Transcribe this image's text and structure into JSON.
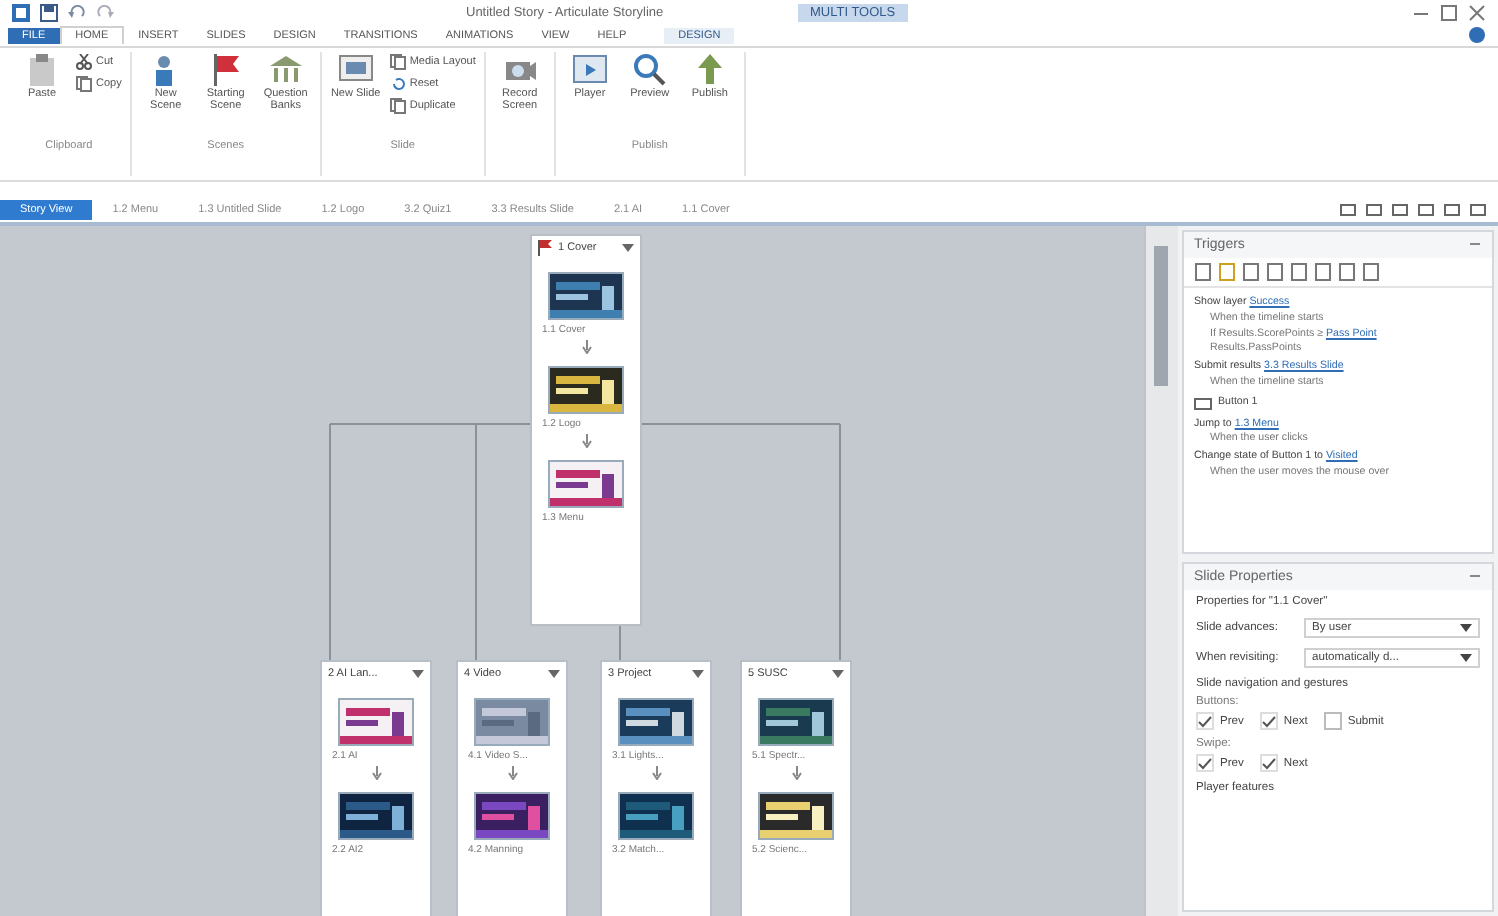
{
  "window": {
    "title": "Untitled Story - Articulate Storyline",
    "contextual_tab": "MULTI TOOLS"
  },
  "ribbon_tabs": [
    {
      "label": "FILE",
      "selected": false,
      "kind": "file"
    },
    {
      "label": "HOME",
      "selected": true,
      "kind": "tab"
    },
    {
      "label": "INSERT",
      "selected": false,
      "kind": "tab"
    },
    {
      "label": "SLIDES",
      "selected": false,
      "kind": "tab"
    },
    {
      "label": "DESIGN",
      "selected": false,
      "kind": "tab"
    },
    {
      "label": "TRANSITIONS",
      "selected": false,
      "kind": "tab"
    },
    {
      "label": "ANIMATIONS",
      "selected": false,
      "kind": "tab"
    },
    {
      "label": "VIEW",
      "selected": false,
      "kind": "tab"
    },
    {
      "label": "HELP",
      "selected": false,
      "kind": "tab"
    },
    {
      "label": "DESIGN",
      "selected": false,
      "kind": "contextual"
    }
  ],
  "ribbon_groups": [
    {
      "label": "Clipboard",
      "items": [
        {
          "kind": "big",
          "label": "Paste"
        },
        {
          "kind": "small",
          "label": "Cut"
        },
        {
          "kind": "small",
          "label": "Copy"
        }
      ]
    },
    {
      "label": "Scenes",
      "items": [
        {
          "kind": "big",
          "label": "New Scene"
        },
        {
          "kind": "big",
          "label": "Starting Scene"
        },
        {
          "kind": "big",
          "label": "Question Banks"
        }
      ]
    },
    {
      "label": "Slide",
      "items": [
        {
          "kind": "big",
          "label": "New Slide"
        },
        {
          "kind": "small",
          "label": "Media Layout"
        },
        {
          "kind": "small",
          "label": "Reset"
        },
        {
          "kind": "small",
          "label": "Duplicate"
        }
      ]
    },
    {
      "items": [
        {
          "kind": "big",
          "label": "Record Screen"
        }
      ]
    },
    {
      "label": "Publish",
      "items": [
        {
          "kind": "big",
          "label": "Player"
        },
        {
          "kind": "big",
          "label": "Preview"
        },
        {
          "kind": "big",
          "label": "Publish"
        }
      ]
    }
  ],
  "view_tabs": [
    {
      "label": "Story View",
      "selected": true
    },
    {
      "label": "1.2 Menu",
      "selected": false
    },
    {
      "label": "1.3 Untitled Slide",
      "selected": false
    },
    {
      "label": "1.2 Logo",
      "selected": false
    },
    {
      "label": "3.2 Quiz1",
      "selected": false
    },
    {
      "label": "3.3 Results Slide",
      "selected": false
    },
    {
      "label": "2.1 AI",
      "selected": false
    },
    {
      "label": "1.1 Cover",
      "selected": false
    }
  ],
  "scenes": [
    {
      "title": "1 Cover",
      "starting": true,
      "slides": [
        "1.1 Cover",
        "1.2 Logo",
        "1.3 Menu"
      ]
    },
    {
      "title": "2 AI Lan...",
      "starting": false,
      "slides": [
        "2.1 AI",
        "2.2 AI2"
      ]
    },
    {
      "title": "4 Video",
      "starting": false,
      "slides": [
        "4.1 Video S...",
        "4.2 Manning"
      ]
    },
    {
      "title": "3 Project",
      "starting": false,
      "slides": [
        "3.1 Lights...",
        "3.2 Match..."
      ]
    },
    {
      "title": "5 SUSC",
      "starting": false,
      "slides": [
        "5.1 Spectr...",
        "5.2 Scienc..."
      ]
    }
  ],
  "triggers": {
    "title": "Triggers",
    "items": [
      {
        "kind": "action",
        "text": "Show layer ",
        "link": "Success"
      },
      {
        "kind": "condition",
        "text": "When the timeline starts"
      },
      {
        "kind": "condition",
        "text": "If Results.ScorePoints ≥ ",
        "link": "Pass Point"
      },
      {
        "kind": "condition",
        "text": "Results.PassPoints"
      },
      {
        "kind": "action",
        "text": "Submit results ",
        "link": "3.3 Results Slide"
      },
      {
        "kind": "condition",
        "text": "When the timeline starts"
      },
      {
        "kind": "object",
        "text": "Button 1"
      },
      {
        "kind": "action",
        "text": "Jump to ",
        "link": "1.3 Menu"
      },
      {
        "kind": "condition",
        "text": "When the user clicks"
      },
      {
        "kind": "action",
        "text": "Change state of Button 1 to ",
        "link": "Visited"
      },
      {
        "kind": "condition",
        "text": "When the user moves the mouse over"
      }
    ]
  },
  "slide_properties": {
    "title": "Slide Properties",
    "for": "Properties for \"1.1 Cover\"",
    "fields": [
      {
        "label": "Slide advances:",
        "value": "By user"
      },
      {
        "label": "When revisiting:",
        "value": "automatically d..."
      }
    ],
    "nav_heading": "Slide navigation and gestures",
    "groups": [
      {
        "label": "Buttons:",
        "options": [
          {
            "label": "Prev",
            "checked": true
          },
          {
            "label": "Next",
            "checked": true
          },
          {
            "label": "Submit",
            "checked": false
          }
        ]
      },
      {
        "label": "Swipe:",
        "options": [
          {
            "label": "Prev",
            "checked": true
          },
          {
            "label": "Next",
            "checked": true
          }
        ]
      }
    ],
    "footer": "Player features"
  }
}
